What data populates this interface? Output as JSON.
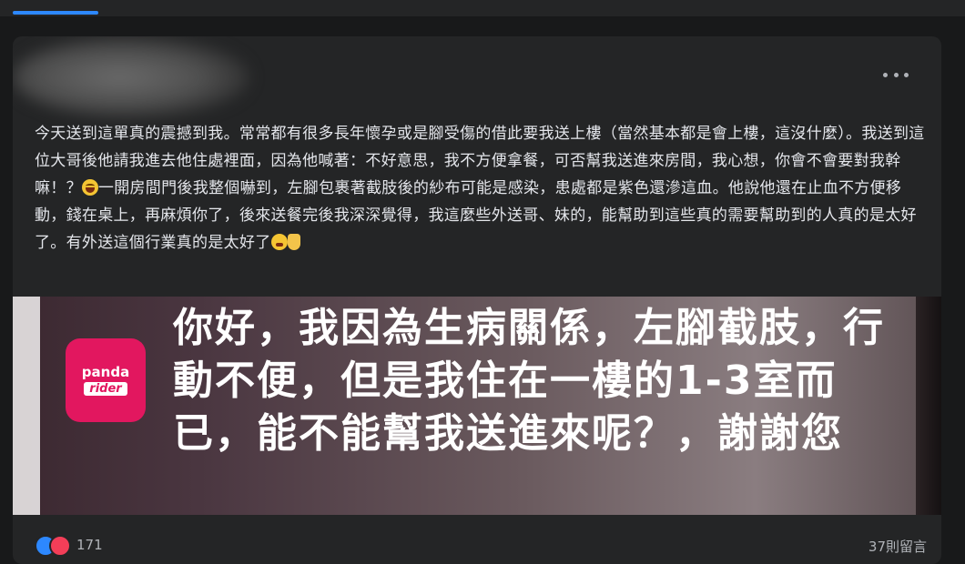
{
  "post": {
    "text_parts": [
      "今天送到這單真的震撼到我。常常都有很多長年懷孕或是腳受傷的借此要我送上樓（當然基本都是會上樓，這沒什麼）。我送到這位大哥後他請我進去他住處裡面，因為他喊著：不好意思，我不方便拿餐，可否幫我送進來房間，我心想，你會不會要對我幹嘛！？",
      "一開房間門後我整個嚇到，左腳包裹著截肢後的紗布可能是感染，患處都是紫色還滲這血。他說他還在止血不方便移動，錢在桌上，再麻煩你了，後來送餐完後我深深覺得，我這麼些外送哥、妹的，能幫助到這些真的需要幫助到的人真的是太好了。有外送這個行業真的是太好了"
    ],
    "emojis": [
      "laughing-crying-emoji",
      "tired-face-emoji",
      "rock-hand-emoji"
    ]
  },
  "image": {
    "logo_word1": "panda",
    "logo_word2": "rider",
    "message": "你好，我因為生病關係，左腳截肢，行動不便，但是我住在一樓的1-3室而已，能不能幫我送進來呢？，謝謝您"
  },
  "footer": {
    "reaction_count": "171",
    "comment_count": "37則留言"
  },
  "colors": {
    "background": "#18191a",
    "card": "#242526",
    "accent": "#2d88ff",
    "panda_pink": "#e2175f"
  }
}
